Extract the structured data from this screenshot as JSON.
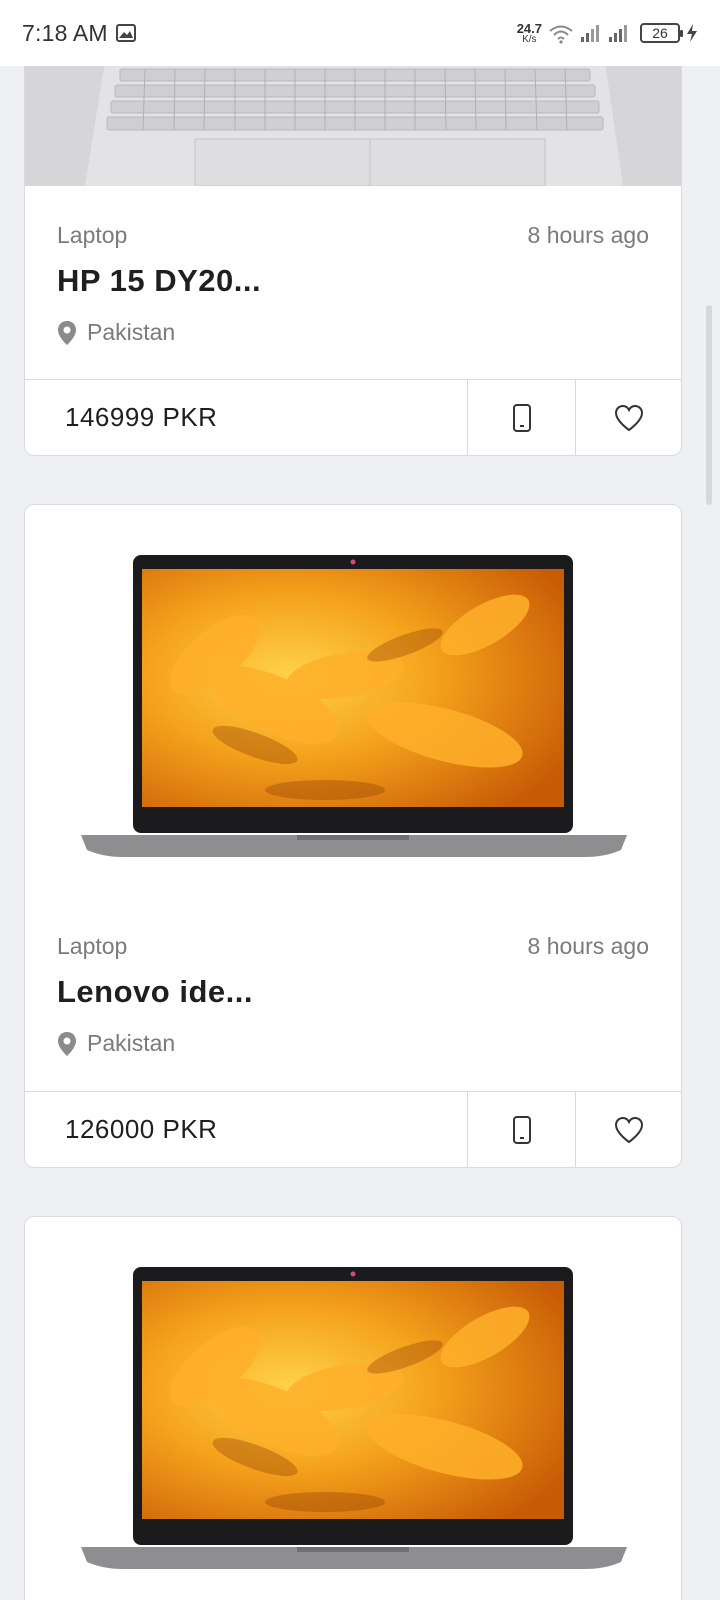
{
  "status_bar": {
    "time": "7:18 AM",
    "net_speed_value": "24.7",
    "net_speed_unit": "K/s",
    "battery": "26"
  },
  "listings": [
    {
      "category": "Laptop",
      "time_ago": "8 hours ago",
      "title": "HP 15 DY20...",
      "location": "Pakistan",
      "price": "146999 PKR",
      "image_icon": "laptop-keyboard-image"
    },
    {
      "category": "Laptop",
      "time_ago": "8 hours ago",
      "title": "Lenovo ide...",
      "location": "Pakistan",
      "price": "126000 PKR",
      "image_icon": "lenovo-laptop-image"
    },
    {
      "image_icon": "lenovo-laptop-image"
    }
  ],
  "colors": {
    "background": "#eff0f4",
    "card": "#ffffff",
    "border": "#d9d9de",
    "muted_text": "#7a7a7f",
    "screen_orange": "#f39a1c"
  }
}
